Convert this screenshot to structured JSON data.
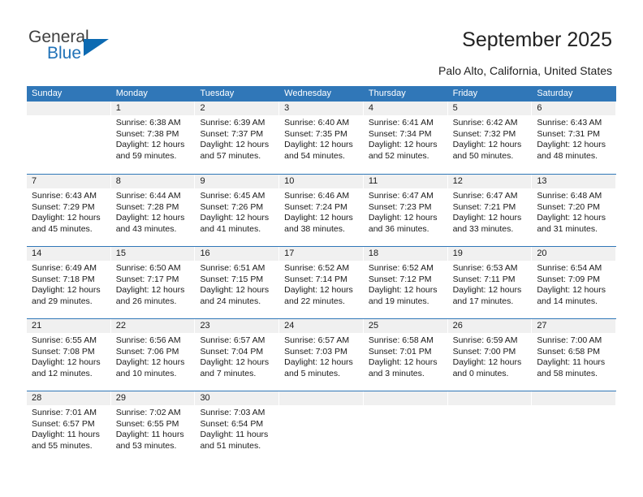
{
  "brand": {
    "name_part1": "General",
    "name_part2": "Blue",
    "triangle_icon": "triangle-icon"
  },
  "header": {
    "title": "September 2025",
    "subtitle": "Palo Alto, California, United States"
  },
  "colors": {
    "header_blue": "#3077b8",
    "daynum_gray": "#f0f0f0",
    "brand_blue": "#2072b8",
    "text": "#1a1a1a"
  },
  "calendar": {
    "weekdays": [
      "Sunday",
      "Monday",
      "Tuesday",
      "Wednesday",
      "Thursday",
      "Friday",
      "Saturday"
    ],
    "weeks": [
      [
        {
          "day": "",
          "empty": true,
          "sunrise": "",
          "sunset": "",
          "daylight_line1": "",
          "daylight_line2": ""
        },
        {
          "day": "1",
          "sunrise": "Sunrise: 6:38 AM",
          "sunset": "Sunset: 7:38 PM",
          "daylight_line1": "Daylight: 12 hours",
          "daylight_line2": "and 59 minutes."
        },
        {
          "day": "2",
          "sunrise": "Sunrise: 6:39 AM",
          "sunset": "Sunset: 7:37 PM",
          "daylight_line1": "Daylight: 12 hours",
          "daylight_line2": "and 57 minutes."
        },
        {
          "day": "3",
          "sunrise": "Sunrise: 6:40 AM",
          "sunset": "Sunset: 7:35 PM",
          "daylight_line1": "Daylight: 12 hours",
          "daylight_line2": "and 54 minutes."
        },
        {
          "day": "4",
          "sunrise": "Sunrise: 6:41 AM",
          "sunset": "Sunset: 7:34 PM",
          "daylight_line1": "Daylight: 12 hours",
          "daylight_line2": "and 52 minutes."
        },
        {
          "day": "5",
          "sunrise": "Sunrise: 6:42 AM",
          "sunset": "Sunset: 7:32 PM",
          "daylight_line1": "Daylight: 12 hours",
          "daylight_line2": "and 50 minutes."
        },
        {
          "day": "6",
          "sunrise": "Sunrise: 6:43 AM",
          "sunset": "Sunset: 7:31 PM",
          "daylight_line1": "Daylight: 12 hours",
          "daylight_line2": "and 48 minutes."
        }
      ],
      [
        {
          "day": "7",
          "sunrise": "Sunrise: 6:43 AM",
          "sunset": "Sunset: 7:29 PM",
          "daylight_line1": "Daylight: 12 hours",
          "daylight_line2": "and 45 minutes."
        },
        {
          "day": "8",
          "sunrise": "Sunrise: 6:44 AM",
          "sunset": "Sunset: 7:28 PM",
          "daylight_line1": "Daylight: 12 hours",
          "daylight_line2": "and 43 minutes."
        },
        {
          "day": "9",
          "sunrise": "Sunrise: 6:45 AM",
          "sunset": "Sunset: 7:26 PM",
          "daylight_line1": "Daylight: 12 hours",
          "daylight_line2": "and 41 minutes."
        },
        {
          "day": "10",
          "sunrise": "Sunrise: 6:46 AM",
          "sunset": "Sunset: 7:24 PM",
          "daylight_line1": "Daylight: 12 hours",
          "daylight_line2": "and 38 minutes."
        },
        {
          "day": "11",
          "sunrise": "Sunrise: 6:47 AM",
          "sunset": "Sunset: 7:23 PM",
          "daylight_line1": "Daylight: 12 hours",
          "daylight_line2": "and 36 minutes."
        },
        {
          "day": "12",
          "sunrise": "Sunrise: 6:47 AM",
          "sunset": "Sunset: 7:21 PM",
          "daylight_line1": "Daylight: 12 hours",
          "daylight_line2": "and 33 minutes."
        },
        {
          "day": "13",
          "sunrise": "Sunrise: 6:48 AM",
          "sunset": "Sunset: 7:20 PM",
          "daylight_line1": "Daylight: 12 hours",
          "daylight_line2": "and 31 minutes."
        }
      ],
      [
        {
          "day": "14",
          "sunrise": "Sunrise: 6:49 AM",
          "sunset": "Sunset: 7:18 PM",
          "daylight_line1": "Daylight: 12 hours",
          "daylight_line2": "and 29 minutes."
        },
        {
          "day": "15",
          "sunrise": "Sunrise: 6:50 AM",
          "sunset": "Sunset: 7:17 PM",
          "daylight_line1": "Daylight: 12 hours",
          "daylight_line2": "and 26 minutes."
        },
        {
          "day": "16",
          "sunrise": "Sunrise: 6:51 AM",
          "sunset": "Sunset: 7:15 PM",
          "daylight_line1": "Daylight: 12 hours",
          "daylight_line2": "and 24 minutes."
        },
        {
          "day": "17",
          "sunrise": "Sunrise: 6:52 AM",
          "sunset": "Sunset: 7:14 PM",
          "daylight_line1": "Daylight: 12 hours",
          "daylight_line2": "and 22 minutes."
        },
        {
          "day": "18",
          "sunrise": "Sunrise: 6:52 AM",
          "sunset": "Sunset: 7:12 PM",
          "daylight_line1": "Daylight: 12 hours",
          "daylight_line2": "and 19 minutes."
        },
        {
          "day": "19",
          "sunrise": "Sunrise: 6:53 AM",
          "sunset": "Sunset: 7:11 PM",
          "daylight_line1": "Daylight: 12 hours",
          "daylight_line2": "and 17 minutes."
        },
        {
          "day": "20",
          "sunrise": "Sunrise: 6:54 AM",
          "sunset": "Sunset: 7:09 PM",
          "daylight_line1": "Daylight: 12 hours",
          "daylight_line2": "and 14 minutes."
        }
      ],
      [
        {
          "day": "21",
          "sunrise": "Sunrise: 6:55 AM",
          "sunset": "Sunset: 7:08 PM",
          "daylight_line1": "Daylight: 12 hours",
          "daylight_line2": "and 12 minutes."
        },
        {
          "day": "22",
          "sunrise": "Sunrise: 6:56 AM",
          "sunset": "Sunset: 7:06 PM",
          "daylight_line1": "Daylight: 12 hours",
          "daylight_line2": "and 10 minutes."
        },
        {
          "day": "23",
          "sunrise": "Sunrise: 6:57 AM",
          "sunset": "Sunset: 7:04 PM",
          "daylight_line1": "Daylight: 12 hours",
          "daylight_line2": "and 7 minutes."
        },
        {
          "day": "24",
          "sunrise": "Sunrise: 6:57 AM",
          "sunset": "Sunset: 7:03 PM",
          "daylight_line1": "Daylight: 12 hours",
          "daylight_line2": "and 5 minutes."
        },
        {
          "day": "25",
          "sunrise": "Sunrise: 6:58 AM",
          "sunset": "Sunset: 7:01 PM",
          "daylight_line1": "Daylight: 12 hours",
          "daylight_line2": "and 3 minutes."
        },
        {
          "day": "26",
          "sunrise": "Sunrise: 6:59 AM",
          "sunset": "Sunset: 7:00 PM",
          "daylight_line1": "Daylight: 12 hours",
          "daylight_line2": "and 0 minutes."
        },
        {
          "day": "27",
          "sunrise": "Sunrise: 7:00 AM",
          "sunset": "Sunset: 6:58 PM",
          "daylight_line1": "Daylight: 11 hours",
          "daylight_line2": "and 58 minutes."
        }
      ],
      [
        {
          "day": "28",
          "sunrise": "Sunrise: 7:01 AM",
          "sunset": "Sunset: 6:57 PM",
          "daylight_line1": "Daylight: 11 hours",
          "daylight_line2": "and 55 minutes."
        },
        {
          "day": "29",
          "sunrise": "Sunrise: 7:02 AM",
          "sunset": "Sunset: 6:55 PM",
          "daylight_line1": "Daylight: 11 hours",
          "daylight_line2": "and 53 minutes."
        },
        {
          "day": "30",
          "sunrise": "Sunrise: 7:03 AM",
          "sunset": "Sunset: 6:54 PM",
          "daylight_line1": "Daylight: 11 hours",
          "daylight_line2": "and 51 minutes."
        },
        {
          "day": "",
          "empty": true,
          "sunrise": "",
          "sunset": "",
          "daylight_line1": "",
          "daylight_line2": ""
        },
        {
          "day": "",
          "empty": true,
          "sunrise": "",
          "sunset": "",
          "daylight_line1": "",
          "daylight_line2": ""
        },
        {
          "day": "",
          "empty": true,
          "sunrise": "",
          "sunset": "",
          "daylight_line1": "",
          "daylight_line2": ""
        },
        {
          "day": "",
          "empty": true,
          "sunrise": "",
          "sunset": "",
          "daylight_line1": "",
          "daylight_line2": ""
        }
      ]
    ]
  }
}
